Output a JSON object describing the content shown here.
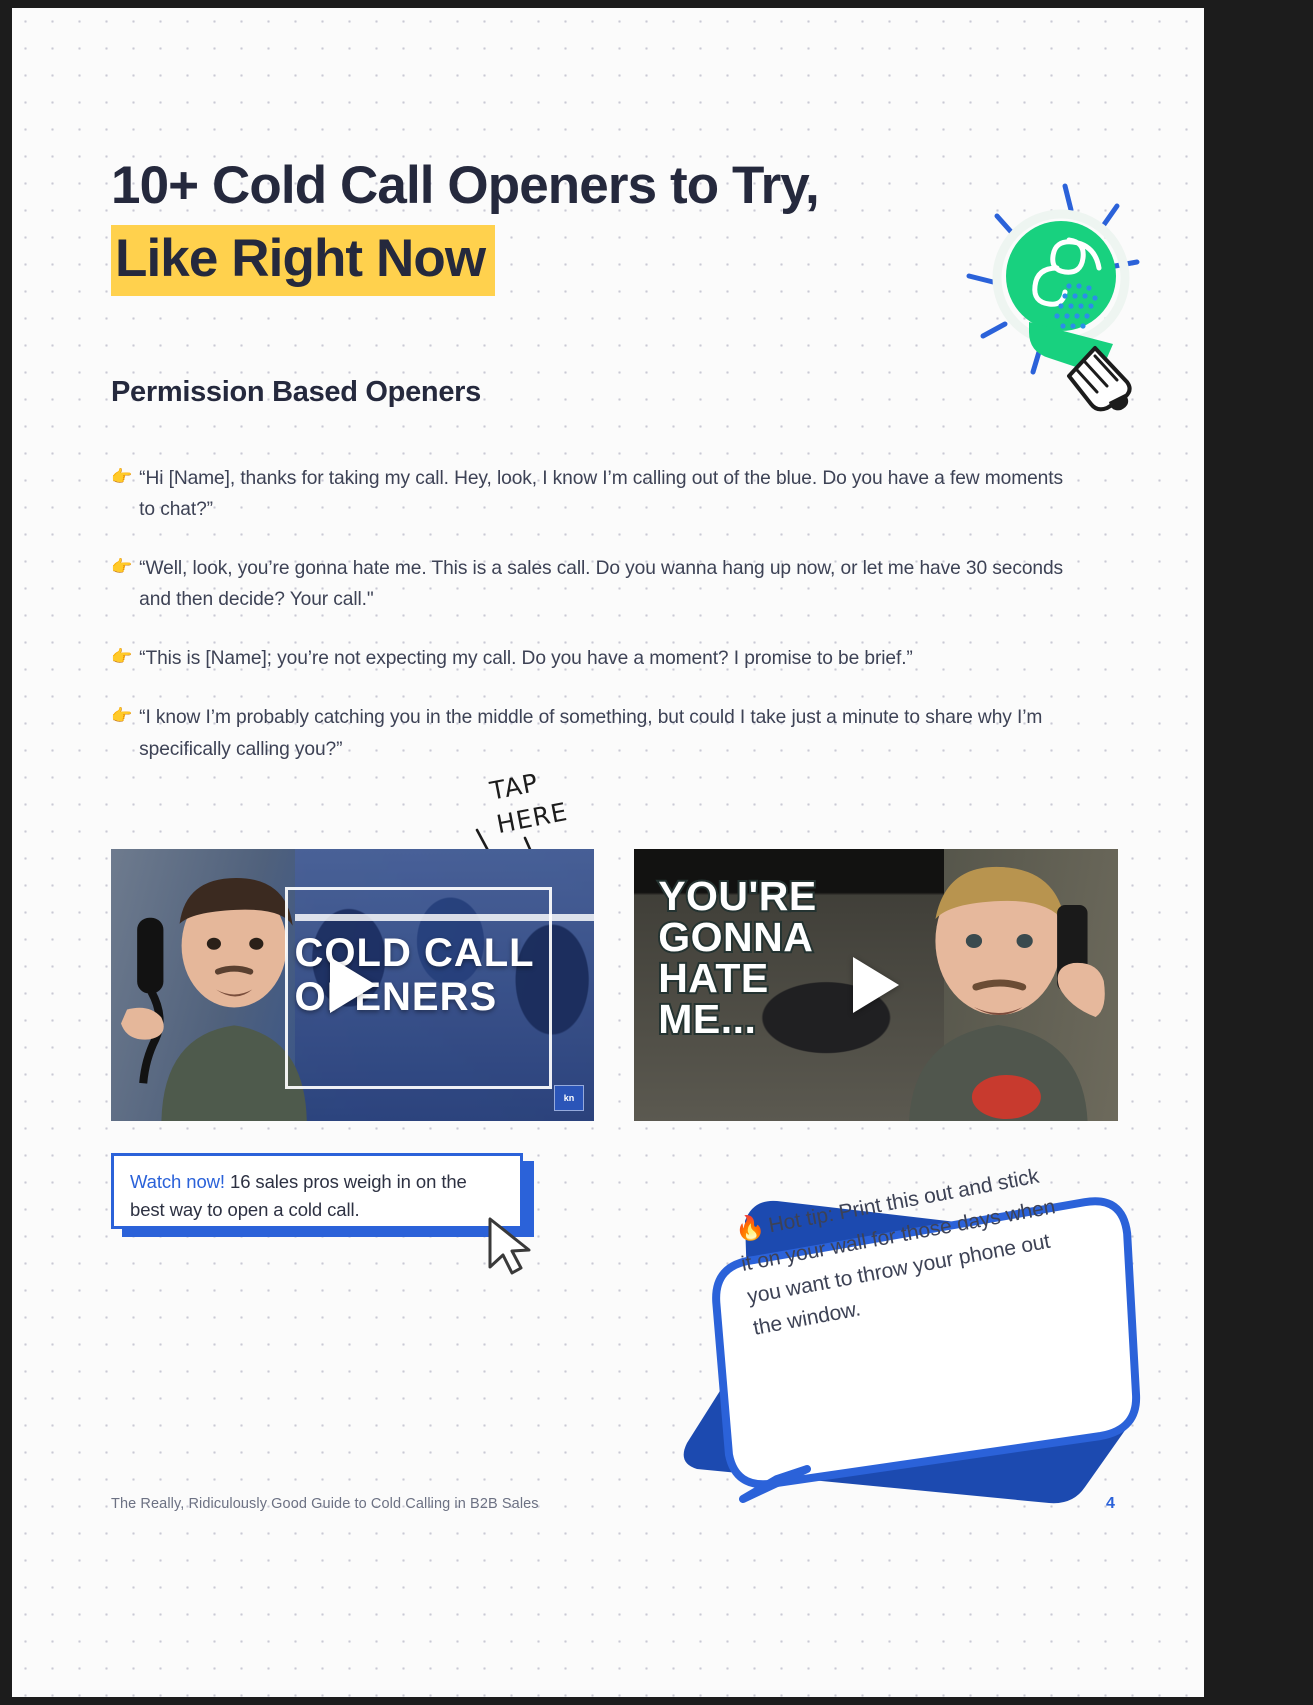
{
  "document": {
    "title_line_1": "10+ Cold Call Openers to Try,",
    "title_line_2": "Like Right Now",
    "section_heading": "Permission Based Openers",
    "highlight_color": "#ffd14d",
    "accent_color": "#2b62d9",
    "text_color": "#25293d"
  },
  "openers": [
    {
      "icon": "👉",
      "text": "“Hi [Name], thanks for taking my call. Hey, look, I know I’m calling out of the blue. Do you have a few moments to chat?”"
    },
    {
      "icon": "👉",
      "text": "“Well, look, you’re gonna hate me. This is a sales call. Do you wanna hang up now, or let me have 30 seconds and then decide? Your call.\""
    },
    {
      "icon": "👉",
      "text": "“This is [Name]; you’re not expecting my call. Do you have a moment? I promise to be brief.”"
    },
    {
      "icon": "👉",
      "text": "“I know I’m probably catching you in the middle of something, but could I take just a minute to share why I’m specifically calling you?”"
    }
  ],
  "annotation": {
    "tap_line_1": "TAP",
    "tap_line_2": "HERE"
  },
  "videos": [
    {
      "title_line_1": "COLD CALL",
      "title_line_2": "OPENERS",
      "badge": "kn",
      "play_label": "play-button"
    },
    {
      "title_line_1": "YOU'RE",
      "title_line_2": "GONNA",
      "title_line_3": "HATE",
      "title_line_4": "ME...",
      "play_label": "play-button"
    }
  ],
  "watch_callout": {
    "link_text": "Watch now!",
    "body_text": " 16 sales pros weigh in on the best way to open a cold call."
  },
  "hot_tip": {
    "icon": "🔥",
    "text": "Hot tip: Print this out and stick it on your wall for those days when you want to throw your phone out the window."
  },
  "footer": {
    "text": "The Really, Ridiculously Good Guide to Cold Calling in B2B Sales",
    "page_number": "4"
  }
}
